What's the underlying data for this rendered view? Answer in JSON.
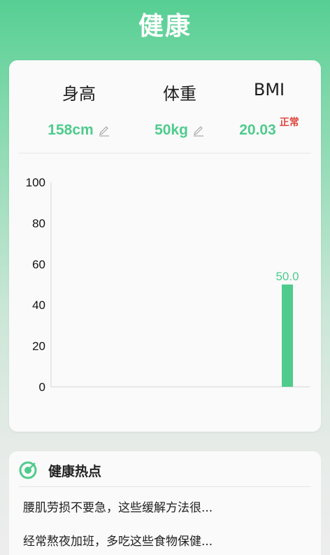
{
  "header": {
    "title": "健康"
  },
  "metrics": {
    "height": {
      "label": "身高",
      "value": "158cm"
    },
    "weight": {
      "label": "体重",
      "value": "50kg"
    },
    "bmi": {
      "label": "BMI",
      "value": "20.03",
      "status": "正常"
    }
  },
  "colors": {
    "accent": "#4fcb8d",
    "status_normal": "#e0463f"
  },
  "chart_data": {
    "type": "bar",
    "categories": [
      ""
    ],
    "values": [
      50.0
    ],
    "value_labels": [
      "50.0"
    ],
    "yticks": [
      "0",
      "20",
      "40",
      "60",
      "80",
      "100"
    ],
    "ylim": [
      0,
      100
    ],
    "grid": false,
    "title": "",
    "xlabel": "",
    "ylabel": ""
  },
  "hot": {
    "title": "健康热点",
    "items": [
      "腰肌劳损不要急，这些缓解方法很...",
      "经常熬夜加班，多吃这些食物保健..."
    ]
  }
}
